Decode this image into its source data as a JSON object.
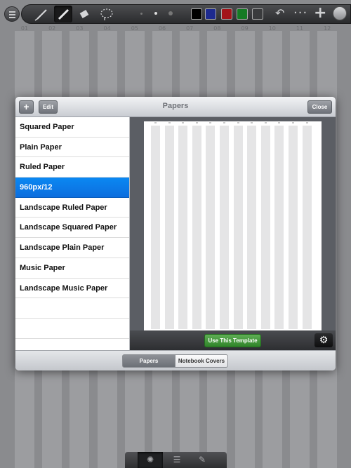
{
  "background_page": {
    "column_numbers": [
      "01",
      "02",
      "03",
      "04",
      "05",
      "06",
      "07",
      "08",
      "09",
      "10",
      "11",
      "12"
    ]
  },
  "toolbar": {
    "colors": [
      "#000000",
      "#1d2a8f",
      "#a3151a",
      "#157a24",
      "#3a3b3d"
    ]
  },
  "modal": {
    "title": "Papers",
    "add_label": "+",
    "edit_label": "Edit",
    "close_label": "Close",
    "papers": [
      "Squared Paper",
      "Plain Paper",
      "Ruled Paper",
      "960px/12",
      "Landscape Ruled Paper",
      "Landscape Squared Paper",
      "Landscape Plain Paper",
      "Music Paper",
      "Landscape Music Paper"
    ],
    "selected_index": 3,
    "use_template_label": "Use This Template",
    "tabs": {
      "papers": "Papers",
      "notebook_covers": "Notebook Covers"
    }
  }
}
